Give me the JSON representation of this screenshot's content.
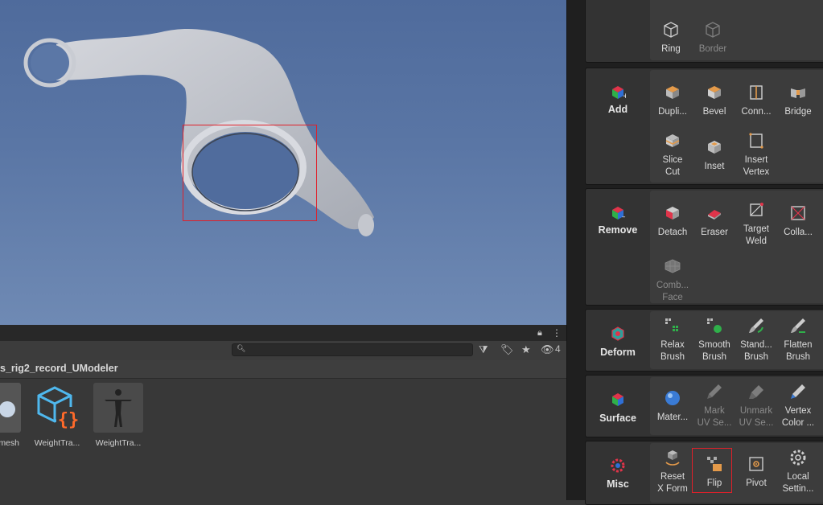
{
  "project": {
    "breadcrumb": "s_rig2_record_UModeler",
    "hidden_count": "4",
    "assets": [
      {
        "label": "mesh",
        "icon": "mesh-thumbnail"
      },
      {
        "label": "WeightTra...",
        "icon": "script-cube-icon"
      },
      {
        "label": "WeightTra...",
        "icon": "character-thumbnail"
      }
    ]
  },
  "panel": {
    "select": {
      "tools": [
        "Ring",
        "Border"
      ]
    },
    "add": {
      "title": "Add",
      "tools": [
        "Dupli...",
        "Bevel",
        "Conn...",
        "Bridge",
        "Slice",
        "Cut",
        "Inset",
        "Insert",
        "Vertex"
      ]
    },
    "remove": {
      "title": "Remove",
      "tools": [
        "Detach",
        "Eraser",
        "Target",
        "Weld",
        "Colla...",
        "Comb...",
        "Face"
      ]
    },
    "deform": {
      "title": "Deform",
      "tools": [
        "Relax",
        "Brush",
        "Smooth",
        "Brush",
        "Stand...",
        "Brush",
        "Flatten",
        "Brush"
      ]
    },
    "surface": {
      "title": "Surface",
      "tools": [
        "Mater...",
        "Mark",
        "UV Se...",
        "Unmark",
        "UV Se...",
        "Vertex",
        "Color ..."
      ]
    },
    "misc": {
      "title": "Misc",
      "tools": [
        "Reset",
        "X Form",
        "Flip",
        "Pivot",
        "Local",
        "Settin..."
      ]
    }
  },
  "colors": {
    "accent_highlight": "#e0202a",
    "panel_bg": "#1f1f1f",
    "viewport_sky": "#5a76a5"
  }
}
